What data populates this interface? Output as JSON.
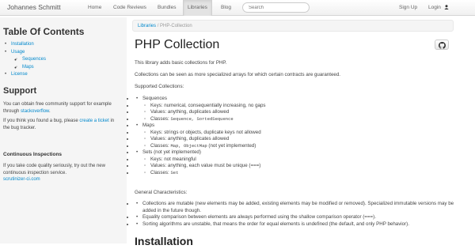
{
  "nav": {
    "brand": "Johannes Schmitt",
    "links": [
      "Home",
      "Code Reviews",
      "Bundles",
      "Libraries",
      "Blog"
    ],
    "search_placeholder": "Search",
    "signup": "Sign Up",
    "login": "Login"
  },
  "sidebar": {
    "toc_title": "Table Of Contents",
    "toc": {
      "installation": "Installation",
      "usage": "Usage",
      "sequences": "Sequences",
      "maps": "Maps",
      "license": "License"
    },
    "support_title": "Support",
    "support_text1": "You can obtain free community support for example through",
    "support_link": "stackoverflow",
    "support_text2": "If you think you found a bug, please",
    "bug_link": "create a ticket",
    "support_text3": "in the bug tracker.",
    "ci_title": "Continuous Inspections",
    "ci_text": "If you take code quality seriously, try out the new continuous inspection service.",
    "ci_link": "scrutinizer-ci.com"
  },
  "breadcrumb": {
    "root": "Libraries",
    "sep": "/",
    "current": "PHP-Collection"
  },
  "main": {
    "title": "PHP Collection",
    "intro1": "This library adds basic collections for PHP.",
    "intro2": "Collections can be seen as more specialized arrays for which certain contracts are guaranteed.",
    "supported": "Supported Collections:",
    "sequences": "Sequences",
    "seq_keys": "Keys: numerical, consequentially increasing, no gaps",
    "seq_values": "Values: anything, duplicates allowed",
    "seq_classes_label": "Classes:",
    "seq_classes": "Sequence, SortedSequence",
    "maps": "Maps",
    "map_keys": "Keys: strings or objects, duplicate keys not allowed",
    "map_values": "Values: anything, duplicates allowed",
    "map_classes_label": "Classes:",
    "map_classes": "Map, ObjectMap",
    "map_classes_note": "(not yet implemented)",
    "sets": "Sets (not yet implemented)",
    "set_keys": "Keys: not meaningful",
    "set_values": "Values: anything, each value must be unique (===)",
    "set_classes_label": "Classes:",
    "set_classes": "Set",
    "general": "General Characteristics:",
    "gen1": "Collections are mutable (new elements may be added, existing elements may be modified or removed). Specialized immutable versions may be added in the future though.",
    "gen2": "Equality comparison between elements are always performed using the shallow comparison operator (===).",
    "gen3": "Sorting algorithms are unstable, that means the order for equal elements is undefined (the default, and only PHP behavior).",
    "installation_heading": "Installation"
  },
  "colors": {
    "link": "#0088cc",
    "sidebar_bg": "#f5f5f5"
  }
}
